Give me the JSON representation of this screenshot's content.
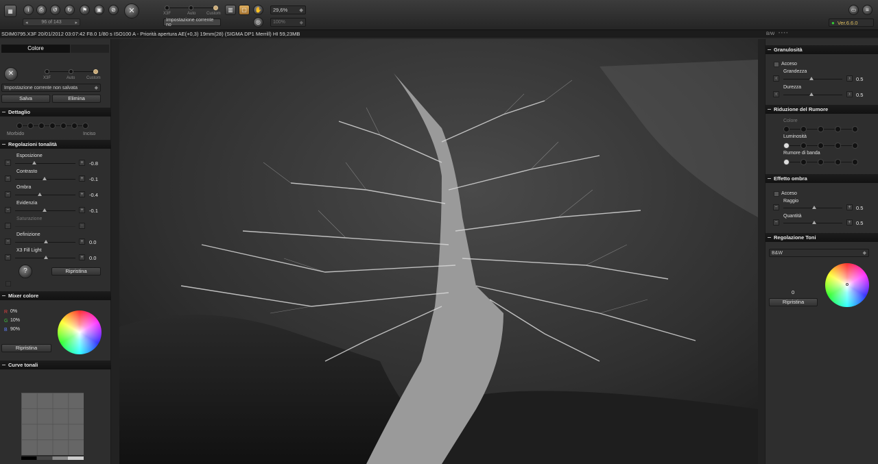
{
  "toolbar": {
    "nav_counter": "96 of 143",
    "presets": [
      "X3F",
      "Auto",
      "Custom"
    ],
    "preset_field": "Impostazione corrente no",
    "zoom": "29,6%",
    "zoom2": "100%",
    "version": "Ver.6.6.0"
  },
  "infobar": {
    "text": "SDIM0795.X3F 20/01/2012 03:07:42 F8.0 1/80 s ISO100 A - Priorità apertura AE(+0,3) 19mm(28) (SIGMA DP1 Merrill) HI 59,23MB",
    "mode": "B/W"
  },
  "left": {
    "tab_active": "Colore",
    "presets": [
      "X3F",
      "Auto",
      "Custom"
    ],
    "preset_select": "Impostazione corrente non salvata",
    "save": "Salva",
    "delete": "Elimina",
    "detail": {
      "title": "Dettaglio",
      "left": "Morbido",
      "right": "Inciso"
    },
    "tone": {
      "title": "Regolazioni tonalità",
      "rows": [
        {
          "label": "Esposizione",
          "value": "-0.8"
        },
        {
          "label": "Contrasto",
          "value": "-0.1"
        },
        {
          "label": "Ombra",
          "value": "-0.4"
        },
        {
          "label": "Evidenzia",
          "value": "-0.1"
        },
        {
          "label": "Saturazione",
          "value": ""
        },
        {
          "label": "Definizione",
          "value": "0.0"
        },
        {
          "label": "X3 Fill Light",
          "value": "0.0"
        }
      ],
      "reset": "Ripristina"
    },
    "mixer": {
      "title": "Mixer colore",
      "r": "R",
      "r_val": "0%",
      "g": "G",
      "g_val": "10%",
      "b": "B",
      "b_val": "90%",
      "reset": "Ripristina"
    },
    "curves": {
      "title": "Curve tonali"
    }
  },
  "right": {
    "grain": {
      "title": "Granulosità",
      "on": "Acceso",
      "size": "Grandezza",
      "size_val": "0.5",
      "hard": "Durezza",
      "hard_val": "0.5"
    },
    "noise": {
      "title": "Riduzione del Rumore",
      "color": "Colore",
      "lum": "Luminosità",
      "band": "Rumore di banda"
    },
    "shadow": {
      "title": "Effetto ombra",
      "on": "Acceso",
      "radius": "Raggio",
      "radius_val": "0.5",
      "qty": "Quantità",
      "qty_val": "0.5"
    },
    "toning": {
      "title": "Regolazione Toni",
      "select": "B&W",
      "value": "0",
      "reset": "Ripristina"
    }
  },
  "colors": {
    "accent": "#c8a878",
    "panel": "#2e2e2e",
    "header": "#161616"
  }
}
